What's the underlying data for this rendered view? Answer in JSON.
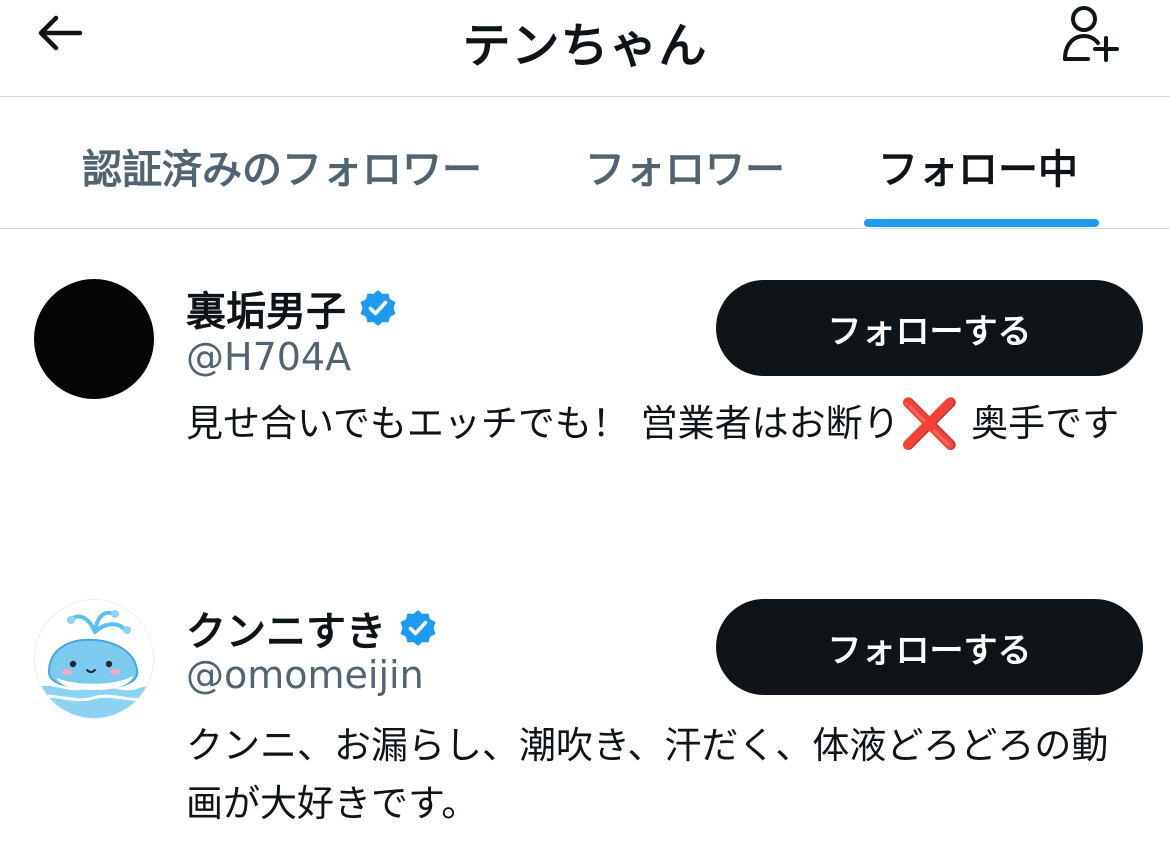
{
  "header": {
    "title": "テンちゃん",
    "back_icon": "back-arrow-icon",
    "add_user_icon": "add-user-icon"
  },
  "tabs": [
    {
      "label": "認証済みのフォロワー",
      "active": false
    },
    {
      "label": "フォロワー",
      "active": false
    },
    {
      "label": "フォロー中",
      "active": true
    }
  ],
  "colors": {
    "accent": "#1d9bf0",
    "text": "#0f1419",
    "secondary": "#536471",
    "button_bg": "#0f1419"
  },
  "users": [
    {
      "name": "裏垢男子",
      "handle": "@H704A",
      "verified": true,
      "bio_part1": "見せ合いでもエッチでも！ 営業者はお断り",
      "bio_emoji": "❌",
      "bio_part2": " 奥手です",
      "follow_label": "フォローする",
      "avatar": "dark-avatar"
    },
    {
      "name": "クンニすき",
      "handle": "@omomeijin",
      "verified": true,
      "bio_part1": "クンニ、お漏らし、潮吹き、汗だく、体液どろどろの動画が大好きです。",
      "follow_label": "フォローする",
      "avatar": "whale-avatar"
    }
  ]
}
